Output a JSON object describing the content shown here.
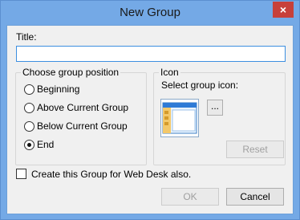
{
  "window": {
    "title": "New Group",
    "close_label": "×"
  },
  "form": {
    "title_label": "Title:",
    "title_value": ""
  },
  "position_group": {
    "caption": "Choose group position",
    "options": [
      {
        "label": "Beginning",
        "checked": false
      },
      {
        "label": "Above Current Group",
        "checked": false
      },
      {
        "label": "Below Current Group",
        "checked": false
      },
      {
        "label": "End",
        "checked": true
      }
    ]
  },
  "icon_group": {
    "caption": "Icon",
    "select_label": "Select group icon:",
    "browse_label": "...",
    "reset_label": "Reset"
  },
  "web_desk": {
    "label": "Create this Group for Web Desk also.",
    "checked": false
  },
  "buttons": {
    "ok_label": "OK",
    "cancel_label": "Cancel"
  },
  "colors": {
    "frame": "#74a9e6",
    "close": "#c7403a",
    "input_focus": "#3c8fe0"
  }
}
